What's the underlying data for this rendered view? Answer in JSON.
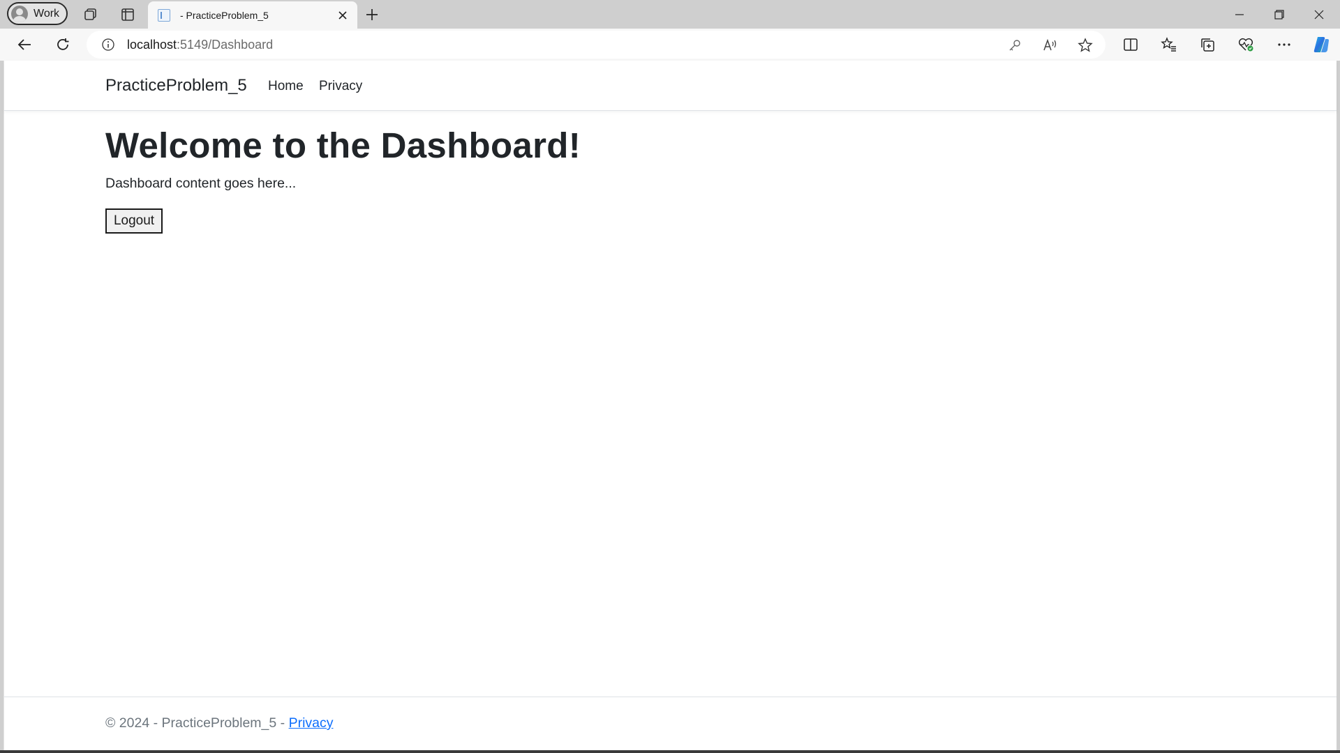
{
  "browser": {
    "profile_label": "Work",
    "tab_title": "- PracticeProblem_5",
    "url_host": "localhost",
    "url_path": ":5149/Dashboard",
    "icons": {
      "workspaces": "workspaces-icon",
      "tab_actions": "vertical-tabs-icon",
      "new_tab": "plus-icon",
      "back": "back-arrow-icon",
      "reload": "refresh-icon",
      "site_info": "info-icon",
      "password": "key-icon",
      "read_aloud": "read-aloud-icon",
      "favorite": "star-icon",
      "split_screen": "split-screen-icon",
      "favorites": "favorites-list-icon",
      "collections": "collections-icon",
      "browser_essentials": "heart-pulse-icon",
      "more": "ellipsis-icon",
      "copilot": "copilot-icon"
    }
  },
  "site": {
    "brand": "PracticeProblem_5",
    "nav": [
      {
        "label": "Home"
      },
      {
        "label": "Privacy"
      }
    ]
  },
  "main": {
    "heading": "Welcome to the Dashboard!",
    "content": "Dashboard content goes here...",
    "logout_label": "Logout"
  },
  "footer": {
    "prefix": "© 2024 - PracticeProblem_5 - ",
    "link": "Privacy"
  },
  "colors": {
    "link_blue": "#0d6efd",
    "text_muted": "#6c757d",
    "chrome_gray": "#cfcfcf"
  }
}
